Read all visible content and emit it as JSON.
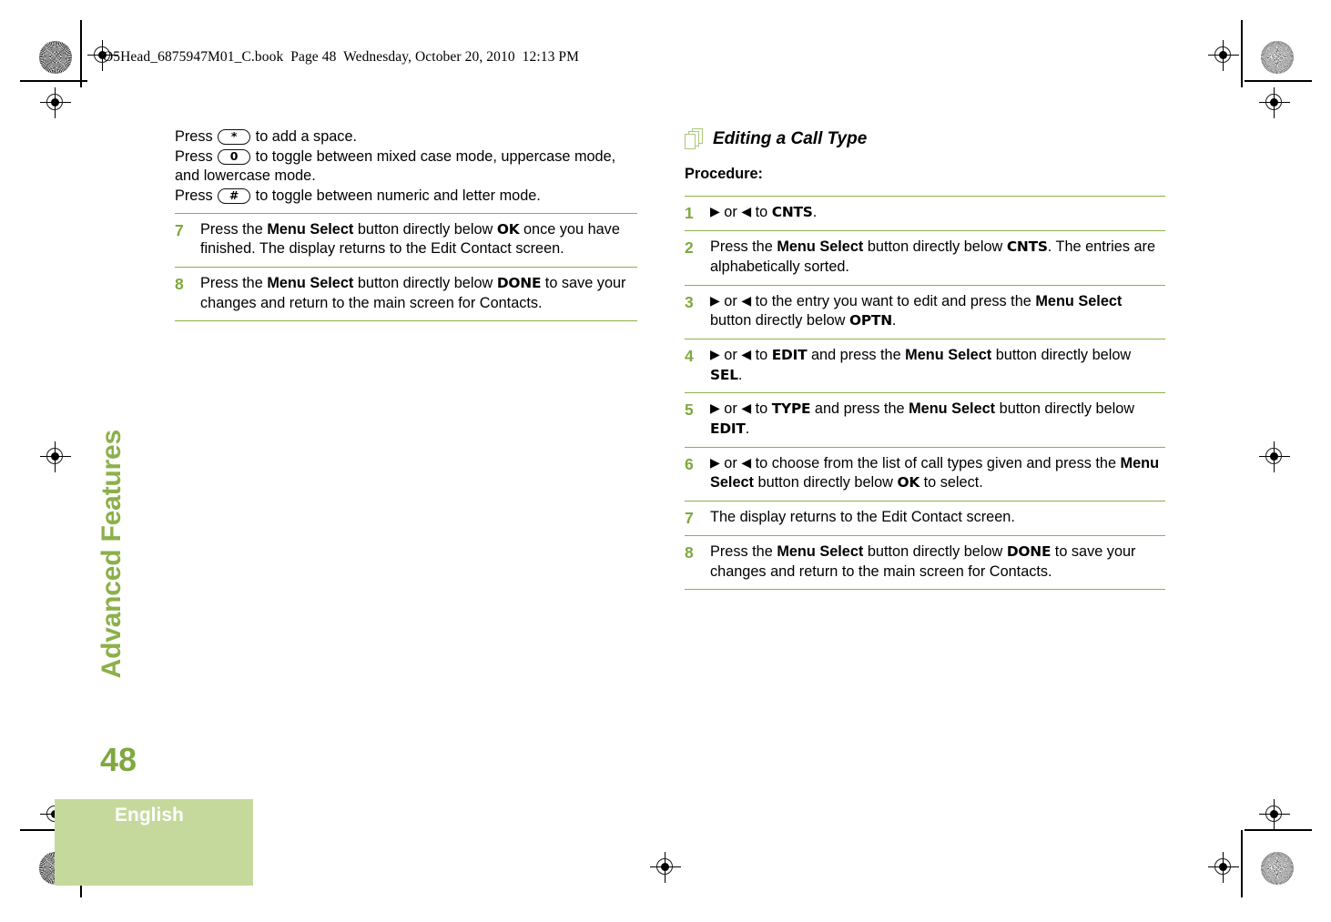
{
  "header": {
    "book_line": "O5Head_6875947M01_C.book  Page 48  Wednesday, October 20, 2010  12:13 PM"
  },
  "sidebar": {
    "chapter_label": "Advanced Features",
    "page_number": "48",
    "language_label": "English"
  },
  "colors": {
    "green_rule": "#8CB04A",
    "green_number": "#7FA83F",
    "green_box": "#C6D99C",
    "icon_green": "#A9C87C"
  },
  "left_column": {
    "intro": {
      "line1_a": "Press ",
      "key1": "*",
      "line1_b": " to add a space.",
      "line2_a": "Press ",
      "key2": "0",
      "line2_b": " to toggle between mixed case mode, uppercase mode, and lowercase mode.",
      "line3_a": "Press ",
      "key3": "#",
      "line3_b": " to toggle between numeric and letter mode."
    },
    "steps": [
      {
        "num": "7",
        "parts": [
          {
            "t": "text",
            "v": "Press the "
          },
          {
            "t": "bold",
            "v": "Menu Select"
          },
          {
            "t": "text",
            "v": " button directly below "
          },
          {
            "t": "lcd",
            "v": "OK"
          },
          {
            "t": "text",
            "v": " once you have finished. The display returns to the Edit Contact screen."
          }
        ]
      },
      {
        "num": "8",
        "parts": [
          {
            "t": "text",
            "v": "Press the "
          },
          {
            "t": "bold",
            "v": "Menu Select"
          },
          {
            "t": "text",
            "v": " button directly below "
          },
          {
            "t": "lcd",
            "v": "DONE"
          },
          {
            "t": "text",
            "v": " to save your changes and return to the main screen for Contacts."
          }
        ]
      }
    ]
  },
  "right_column": {
    "section_title": "Editing a Call Type",
    "section_icon": "stacked-pages-icon",
    "procedure_label": "Procedure:",
    "steps": [
      {
        "num": "1",
        "parts": [
          {
            "t": "arrow",
            "v": "▶"
          },
          {
            "t": "text",
            "v": " or "
          },
          {
            "t": "arrow",
            "v": "◀"
          },
          {
            "t": "text",
            "v": " to "
          },
          {
            "t": "lcd",
            "v": "CNTS"
          },
          {
            "t": "text",
            "v": "."
          }
        ]
      },
      {
        "num": "2",
        "parts": [
          {
            "t": "text",
            "v": "Press the "
          },
          {
            "t": "bold",
            "v": "Menu Select"
          },
          {
            "t": "text",
            "v": " button directly below "
          },
          {
            "t": "lcd",
            "v": "CNTS"
          },
          {
            "t": "text",
            "v": ". The entries are alphabetically sorted."
          }
        ]
      },
      {
        "num": "3",
        "parts": [
          {
            "t": "arrow",
            "v": "▶"
          },
          {
            "t": "text",
            "v": " or "
          },
          {
            "t": "arrow",
            "v": "◀"
          },
          {
            "t": "text",
            "v": " to the entry you want to edit and press the "
          },
          {
            "t": "bold",
            "v": "Menu Select"
          },
          {
            "t": "text",
            "v": " button directly below "
          },
          {
            "t": "lcd",
            "v": "OPTN"
          },
          {
            "t": "text",
            "v": "."
          }
        ]
      },
      {
        "num": "4",
        "parts": [
          {
            "t": "arrow",
            "v": "▶"
          },
          {
            "t": "text",
            "v": " or "
          },
          {
            "t": "arrow",
            "v": "◀"
          },
          {
            "t": "text",
            "v": " to "
          },
          {
            "t": "lcd",
            "v": "EDIT"
          },
          {
            "t": "text",
            "v": " and press the "
          },
          {
            "t": "bold",
            "v": "Menu Select"
          },
          {
            "t": "text",
            "v": " button directly below "
          },
          {
            "t": "lcd",
            "v": "SEL"
          },
          {
            "t": "text",
            "v": "."
          }
        ]
      },
      {
        "num": "5",
        "parts": [
          {
            "t": "arrow",
            "v": "▶"
          },
          {
            "t": "text",
            "v": " or "
          },
          {
            "t": "arrow",
            "v": "◀"
          },
          {
            "t": "text",
            "v": " to "
          },
          {
            "t": "lcd",
            "v": "TYPE"
          },
          {
            "t": "text",
            "v": " and press the "
          },
          {
            "t": "bold",
            "v": "Menu Select"
          },
          {
            "t": "text",
            "v": " button directly below "
          },
          {
            "t": "lcd",
            "v": "EDIT"
          },
          {
            "t": "text",
            "v": "."
          }
        ]
      },
      {
        "num": "6",
        "parts": [
          {
            "t": "arrow",
            "v": "▶"
          },
          {
            "t": "text",
            "v": " or "
          },
          {
            "t": "arrow",
            "v": "◀"
          },
          {
            "t": "text",
            "v": " to choose from the list of call types given and press the "
          },
          {
            "t": "bold",
            "v": "Menu Select"
          },
          {
            "t": "text",
            "v": " button directly below "
          },
          {
            "t": "lcd",
            "v": "OK"
          },
          {
            "t": "text",
            "v": " to select."
          }
        ]
      },
      {
        "num": "7",
        "parts": [
          {
            "t": "text",
            "v": "The display returns to the Edit Contact screen."
          }
        ]
      },
      {
        "num": "8",
        "parts": [
          {
            "t": "text",
            "v": "Press the "
          },
          {
            "t": "bold",
            "v": "Menu Select"
          },
          {
            "t": "text",
            "v": " button directly below "
          },
          {
            "t": "lcd",
            "v": "DONE"
          },
          {
            "t": "text",
            "v": " to save your changes and return to the main screen for Contacts."
          }
        ]
      }
    ]
  }
}
